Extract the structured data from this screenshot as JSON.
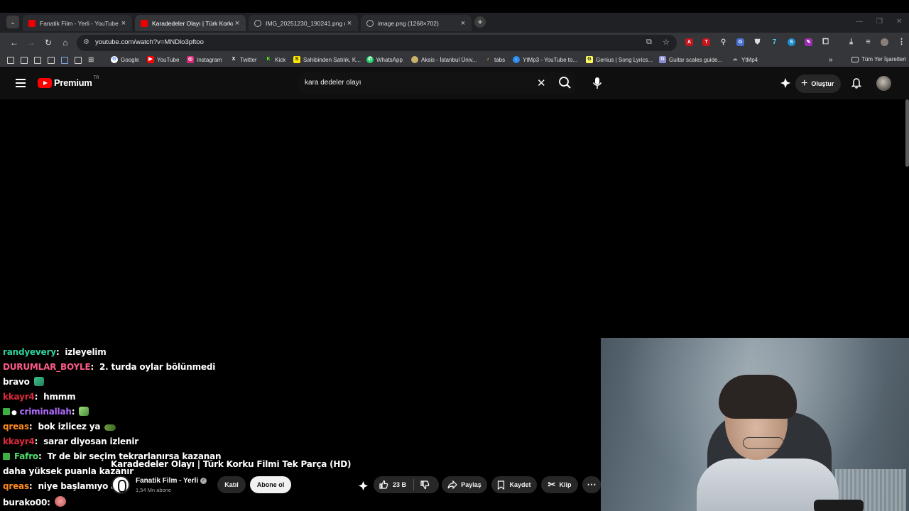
{
  "browser": {
    "tabs": [
      {
        "title": "Fanatik Film - Yerli - YouTube",
        "icon": "youtube-icon",
        "active": false
      },
      {
        "title": "Karadedeler Olayı | Türk Korku",
        "icon": "youtube-icon",
        "active": true
      },
      {
        "title": "IMG_20251230_190241.png (10",
        "icon": "globe-icon",
        "active": false
      },
      {
        "title": "image.png (1268×702)",
        "icon": "globe-icon",
        "active": false
      }
    ],
    "url": "youtube.com/watch?v=MNDlo3pftoo"
  },
  "bookmarks": {
    "items": [
      {
        "label": "Google",
        "icon": "google-icon",
        "color": "#4285f4"
      },
      {
        "label": "YouTube",
        "icon": "youtube-icon",
        "color": "#ff0000"
      },
      {
        "label": "Instagram",
        "icon": "instagram-icon",
        "color": "#d62976"
      },
      {
        "label": "Twitter",
        "icon": "x-icon",
        "color": "#ffffff"
      },
      {
        "label": "Kick",
        "icon": "kick-icon",
        "color": "#53fc18"
      },
      {
        "label": "Sahibinden Satılık, K...",
        "icon": "sahibinden-icon",
        "color": "#ffe800"
      },
      {
        "label": "WhatsApp",
        "icon": "whatsapp-icon",
        "color": "#25d366"
      },
      {
        "label": "Aksis - İstanbul Üniv...",
        "icon": "aksis-icon",
        "color": "#c9b26a"
      },
      {
        "label": "tabs",
        "icon": "tabs-icon",
        "color": "#f0c040"
      },
      {
        "label": "YtMp3 - YouTube to...",
        "icon": "ytmp3-icon",
        "color": "#2b8df0"
      },
      {
        "label": "Genius | Song Lyrics...",
        "icon": "genius-icon",
        "color": "#ffff64"
      },
      {
        "label": "Guitar scales guide...",
        "icon": "guitar-icon",
        "color": "#8a8ad0"
      },
      {
        "label": "YtMp4",
        "icon": "cloud-icon",
        "color": "#9ab"
      }
    ],
    "all_bookmarks": "Tüm Yer İşaretleri"
  },
  "youtube": {
    "logo_text": "Premium",
    "region": "TR",
    "search_query": "kara dedeler olayı",
    "create_label": "Oluştur"
  },
  "chat": [
    {
      "user": "randyevery",
      "user_color": "#2ed3a0",
      "text": "izleyelim"
    },
    {
      "user": "DURUMLAR_BOYLE",
      "user_color": "#ff5a87",
      "text": "2. turda oylar bölünmedi"
    },
    {
      "user": "",
      "user_color": "#ffffff",
      "text": "bravo",
      "emote": true
    },
    {
      "user": "kkayr4",
      "user_color": "#e02a3a",
      "text": "hmmm"
    },
    {
      "user": "criminallah",
      "user_color": "#b26cff",
      "text": "",
      "badge": true,
      "emote": true
    },
    {
      "user": "qreas",
      "user_color": "#ff8a1e",
      "text": "bok izlicez ya",
      "emote": true
    },
    {
      "user": "kkayr4",
      "user_color": "#e02a3a",
      "text": "sarar diyosan izlenir"
    },
    {
      "user": "Fafro",
      "user_color": "#4fe06a",
      "text": "Tr de bir seçim tekrarlanırsa kazanan",
      "badge": true
    },
    {
      "user": "",
      "user_color": "#ffffff",
      "text": "daha yüksek puanla kazanır"
    },
    {
      "user": "qreas",
      "user_color": "#ff8a1e",
      "text": "niye başlamıyo a"
    },
    {
      "user": "burako00",
      "user_color": "#ffffff",
      "text": "",
      "emote": true
    }
  ],
  "video": {
    "title": "Karadedeler Olayı | Türk Korku Filmi Tek Parça (HD)",
    "channel": "Fanatik Film - Yerli",
    "subscribers": "1,54 Mn abone",
    "join_label": "Katıl",
    "subscribe_label": "Abone ol",
    "likes": "23 B",
    "share_label": "Paylaş",
    "save_label": "Kaydet",
    "clip_label": "Klip"
  }
}
